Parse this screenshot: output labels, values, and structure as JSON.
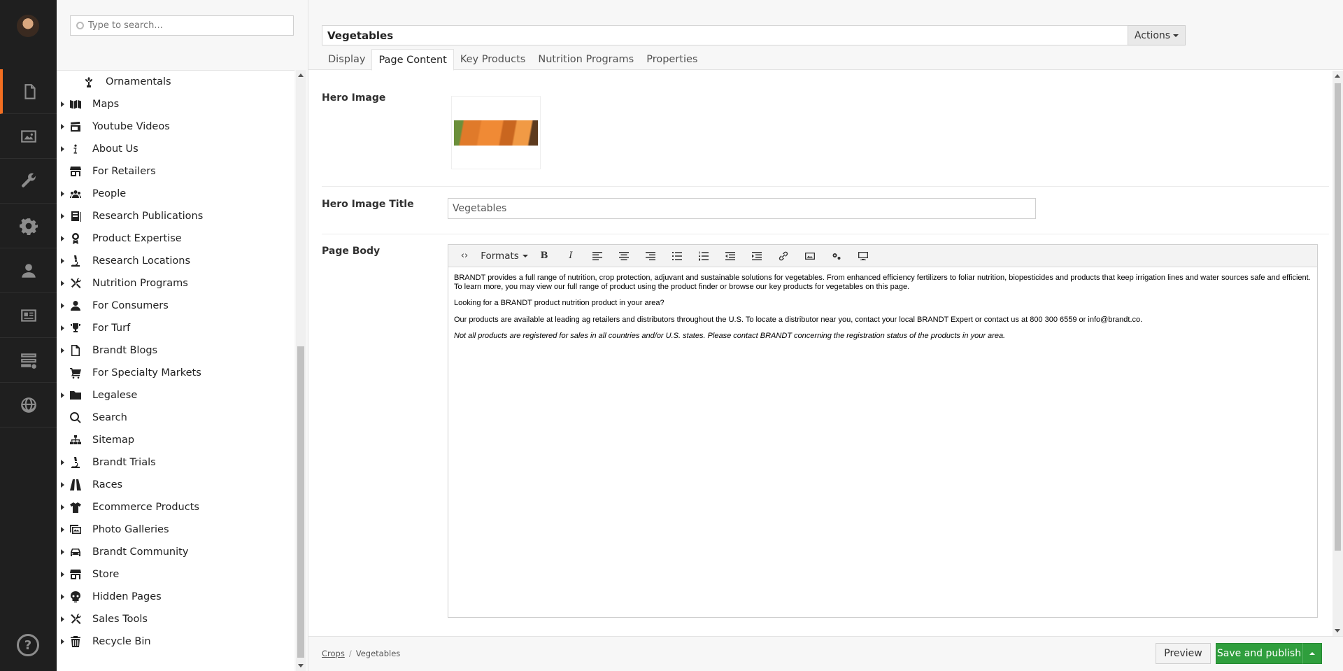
{
  "rail": {
    "sections": [
      {
        "name": "content-icon",
        "active": true
      },
      {
        "name": "media-icon",
        "active": false
      },
      {
        "name": "settings-wrench-icon",
        "active": false
      },
      {
        "name": "developer-gear-icon",
        "active": false
      },
      {
        "name": "users-icon",
        "active": false
      },
      {
        "name": "members-icon",
        "active": false
      },
      {
        "name": "forms-icon",
        "active": false
      },
      {
        "name": "translation-globe-icon",
        "active": false
      }
    ],
    "help": "?"
  },
  "tree": {
    "search_placeholder": "Type to search...",
    "items": [
      {
        "label": "Ornamentals",
        "icon": "plant-icon",
        "expandable": false,
        "child": true
      },
      {
        "label": "Maps",
        "icon": "map-icon",
        "expandable": true
      },
      {
        "label": "Youtube Videos",
        "icon": "video-icon",
        "expandable": true
      },
      {
        "label": "About Us",
        "icon": "info-icon",
        "expandable": true
      },
      {
        "label": "For Retailers",
        "icon": "store-icon",
        "expandable": false
      },
      {
        "label": "People",
        "icon": "people-icon",
        "expandable": true
      },
      {
        "label": "Research Publications",
        "icon": "book-icon",
        "expandable": true
      },
      {
        "label": "Product Expertise",
        "icon": "award-icon",
        "expandable": true
      },
      {
        "label": "Research Locations",
        "icon": "microscope-icon",
        "expandable": true
      },
      {
        "label": "Nutrition Programs",
        "icon": "tools-icon",
        "expandable": true
      },
      {
        "label": "For Consumers",
        "icon": "user-icon",
        "expandable": true
      },
      {
        "label": "For Turf",
        "icon": "trophy-icon",
        "expandable": true
      },
      {
        "label": "Brandt Blogs",
        "icon": "document-icon",
        "expandable": true
      },
      {
        "label": "For Specialty Markets",
        "icon": "cart-icon",
        "expandable": false
      },
      {
        "label": "Legalese",
        "icon": "folder-icon",
        "expandable": true
      },
      {
        "label": "Search",
        "icon": "search-icon",
        "expandable": false
      },
      {
        "label": "Sitemap",
        "icon": "sitemap-icon",
        "expandable": false
      },
      {
        "label": "Brandt Trials",
        "icon": "microscope-icon",
        "expandable": true
      },
      {
        "label": "Races",
        "icon": "road-icon",
        "expandable": true
      },
      {
        "label": "Ecommerce Products",
        "icon": "tshirt-icon",
        "expandable": true
      },
      {
        "label": "Photo Galleries",
        "icon": "photos-icon",
        "expandable": true
      },
      {
        "label": "Brandt Community",
        "icon": "car-icon",
        "expandable": true
      },
      {
        "label": "Store",
        "icon": "store-icon",
        "expandable": true
      },
      {
        "label": "Hidden Pages",
        "icon": "skull-icon",
        "expandable": true
      },
      {
        "label": "Sales Tools",
        "icon": "tools-icon",
        "expandable": true
      },
      {
        "label": "Recycle Bin",
        "icon": "trash-icon",
        "expandable": true
      }
    ]
  },
  "editor": {
    "node_name": "Vegetables",
    "actions_label": "Actions",
    "tabs": [
      {
        "label": "Display",
        "active": false
      },
      {
        "label": "Page Content",
        "active": true
      },
      {
        "label": "Key Products",
        "active": false
      },
      {
        "label": "Nutrition Programs",
        "active": false
      },
      {
        "label": "Properties",
        "active": false
      }
    ],
    "hero_image_label": "Hero Image",
    "hero_image_title_label": "Hero Image Title",
    "hero_image_title_value": "Vegetables",
    "page_body_label": "Page Body",
    "rte": {
      "formats_label": "Formats",
      "paragraphs": [
        "BRANDT provides a full range of nutrition, crop protection, adjuvant and sustainable solutions for vegetables. From enhanced efficiency fertilizers to foliar nutrition, biopesticides and products that keep irrigation lines and water sources safe and efficient. To learn more, you may view our full range of product using the product finder or browse our key products for vegetables on this page.",
        "Looking for a BRANDT product nutrition product in your area?",
        "Our products are available at leading ag retailers and distributors throughout the U.S. To locate a distributor near you, contact your local BRANDT Expert or contact us at 800 300 6559 or info@brandt.co.",
        "Not all products are registered for sales in all countries and/or U.S. states. Please contact BRANDT concerning the registration status of the products in your area."
      ]
    }
  },
  "footer": {
    "breadcrumb": [
      "Crops",
      "Vegetables"
    ],
    "breadcrumb_sep": "/",
    "preview_label": "Preview",
    "save_publish_label": "Save and publish"
  },
  "colors": {
    "rail_bg": "#1f1f1f",
    "rail_active_accent": "#f36f21",
    "save_button": "#2f9e3d"
  }
}
